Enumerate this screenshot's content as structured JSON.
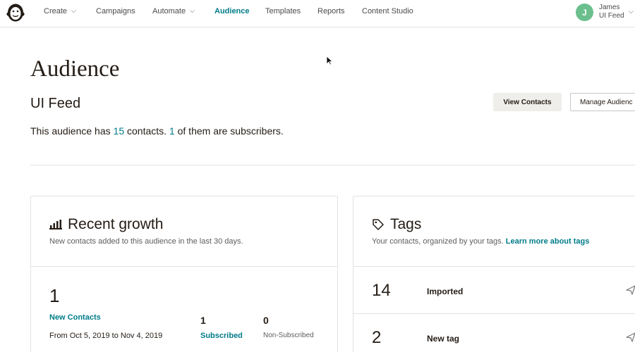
{
  "nav": {
    "items": [
      {
        "label": "Create",
        "dropdown": true
      },
      {
        "label": "Campaigns",
        "dropdown": false
      },
      {
        "label": "Automate",
        "dropdown": true
      },
      {
        "label": "Audience",
        "dropdown": false,
        "active": true
      },
      {
        "label": "Templates",
        "dropdown": false
      },
      {
        "label": "Reports",
        "dropdown": false
      },
      {
        "label": "Content Studio",
        "dropdown": false
      }
    ],
    "user": {
      "initial": "J",
      "name": "James",
      "org": "UI Feed"
    },
    "accent_color": "#007c89"
  },
  "page": {
    "title": "Audience",
    "audience_name": "UI Feed",
    "summary": {
      "prefix": "This audience has ",
      "contacts": "15",
      "middle": " contacts. ",
      "subscribers": "1",
      "suffix": " of them are subscribers."
    },
    "buttons": {
      "view_contacts": "View Contacts",
      "manage": "Manage Audienc"
    }
  },
  "growth": {
    "title": "Recent growth",
    "icon": "bar-chart-icon",
    "subtitle": "New contacts added to this audience in the last 30 days.",
    "new_contacts": "1",
    "new_contacts_label": "New Contacts",
    "range": "From Oct 5, 2019 to Nov 4, 2019",
    "subscribed": "1",
    "subscribed_label": "Subscribed",
    "non_subscribed": "0",
    "non_subscribed_label": "Non-Subscribed"
  },
  "tags": {
    "title": "Tags",
    "icon": "tag-icon",
    "subtitle": "Your contacts, organized by your tags.",
    "learn_more": "Learn more about tags",
    "rows": [
      {
        "count": "14",
        "name": "Imported"
      },
      {
        "count": "2",
        "name": "New tag"
      }
    ]
  }
}
